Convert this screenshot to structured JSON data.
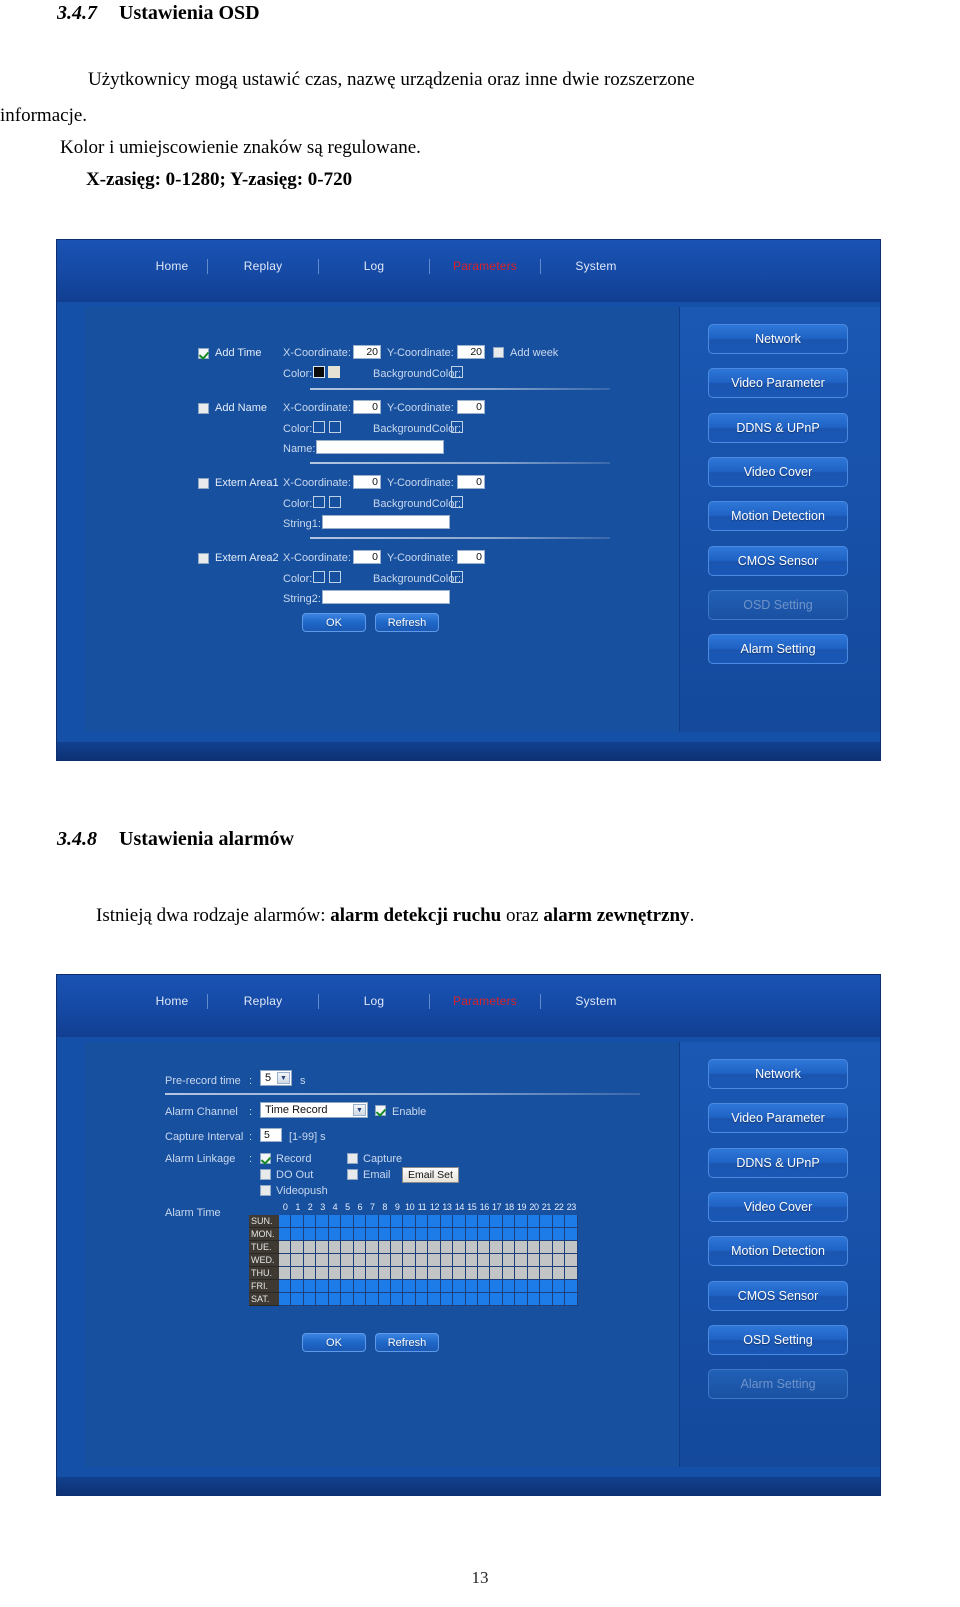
{
  "document": {
    "page_number": "13",
    "section_1": {
      "number": "3.4.7",
      "title": "Ustawienia OSD",
      "paragraph_1": "Użytkownicy mogą ustawić czas, nazwę urządzenia oraz inne dwie rozszerzone",
      "paragraph_1b": "informacje.",
      "paragraph_2": "Kolor i umiejscowienie znaków są regulowane.",
      "paragraph_3": "X-zasięg: 0-1280; Y-zasięg: 0-720"
    },
    "section_2": {
      "number": "3.4.8",
      "title": "Ustawienia alarmów",
      "paragraph_prefix": "Istnieją dwa rodzaje alarmów: ",
      "paragraph_bold_1": "alarm detekcji ruchu",
      "paragraph_middle": " oraz ",
      "paragraph_bold_2": "alarm zewnętrzny",
      "paragraph_suffix": "."
    }
  },
  "colors": {
    "app_background": "#14449c",
    "nav_active": "#d8232a",
    "grid_on": "#1e7ce8",
    "grid_off": "#c2c4c6"
  },
  "osd_screenshot": {
    "nav": {
      "items": [
        {
          "label": "Home",
          "active": false
        },
        {
          "label": "Replay",
          "active": false
        },
        {
          "label": "Log",
          "active": false
        },
        {
          "label": "Parameters",
          "active": true
        },
        {
          "label": "System",
          "active": false
        }
      ]
    },
    "sidebar": {
      "items": [
        {
          "label": "Network",
          "active": false
        },
        {
          "label": "Video Parameter",
          "active": false
        },
        {
          "label": "DDNS & UPnP",
          "active": false
        },
        {
          "label": "Video Cover",
          "active": false
        },
        {
          "label": "Motion Detection",
          "active": false
        },
        {
          "label": "CMOS Sensor",
          "active": false
        },
        {
          "label": "OSD Setting",
          "active": true
        },
        {
          "label": "Alarm Setting",
          "active": false
        }
      ]
    },
    "form": {
      "add_time": {
        "label": "Add Time",
        "checked": true,
        "x_label": "X-Coordinate:",
        "x_value": "20",
        "y_label": "Y-Coordinate:",
        "y_value": "20",
        "add_week_label": "Add week",
        "add_week_checked": false,
        "color_label": "Color:",
        "background_color_label": "BackgroundColor:"
      },
      "add_name": {
        "label": "Add Name",
        "checked": false,
        "x_label": "X-Coordinate:",
        "x_value": "0",
        "y_label": "Y-Coordinate:",
        "y_value": "0",
        "color_label": "Color:",
        "background_color_label": "BackgroundColor:",
        "name_label": "Name:",
        "name_value": ""
      },
      "extern_area1": {
        "label": "Extern Area1",
        "checked": false,
        "x_label": "X-Coordinate:",
        "x_value": "0",
        "y_label": "Y-Coordinate:",
        "y_value": "0",
        "color_label": "Color:",
        "background_color_label": "BackgroundColor:",
        "string_label": "String1:",
        "string_value": ""
      },
      "extern_area2": {
        "label": "Extern Area2",
        "checked": false,
        "x_label": "X-Coordinate:",
        "x_value": "0",
        "y_label": "Y-Coordinate:",
        "y_value": "0",
        "color_label": "Color:",
        "background_color_label": "BackgroundColor:",
        "string_label": "String2:",
        "string_value": ""
      },
      "ok_label": "OK",
      "refresh_label": "Refresh"
    }
  },
  "alarm_screenshot": {
    "nav": {
      "items": [
        {
          "label": "Home",
          "active": false
        },
        {
          "label": "Replay",
          "active": false
        },
        {
          "label": "Log",
          "active": false
        },
        {
          "label": "Parameters",
          "active": true
        },
        {
          "label": "System",
          "active": false
        }
      ]
    },
    "sidebar": {
      "items": [
        {
          "label": "Network",
          "active": false
        },
        {
          "label": "Video Parameter",
          "active": false
        },
        {
          "label": "DDNS & UPnP",
          "active": false
        },
        {
          "label": "Video Cover",
          "active": false
        },
        {
          "label": "Motion Detection",
          "active": false
        },
        {
          "label": "CMOS Sensor",
          "active": false
        },
        {
          "label": "OSD Setting",
          "active": false
        },
        {
          "label": "Alarm Setting",
          "active": true
        }
      ]
    },
    "form": {
      "pre_record_time": {
        "label": "Pre-record time",
        "colon": ":",
        "value": "5",
        "unit": "s"
      },
      "alarm_channel": {
        "label": "Alarm Channel",
        "colon": ":",
        "value": "Time Record",
        "enable_label": "Enable",
        "enable_checked": true
      },
      "capture_interval": {
        "label": "Capture Interval",
        "colon": ":",
        "value": "5",
        "range_hint": "[1-99] s"
      },
      "alarm_linkage": {
        "label": "Alarm Linkage",
        "colon": ":",
        "options": [
          {
            "label": "Record",
            "checked": true
          },
          {
            "label": "Capture",
            "checked": false
          },
          {
            "label": "DO Out",
            "checked": false
          },
          {
            "label": "Email",
            "checked": false
          },
          {
            "label": "Videopush",
            "checked": false
          }
        ],
        "email_set_label": "Email Set"
      },
      "alarm_time": {
        "label": "Alarm Time",
        "hours": [
          "0",
          "1",
          "2",
          "3",
          "4",
          "5",
          "6",
          "7",
          "8",
          "9",
          "10",
          "11",
          "12",
          "13",
          "14",
          "15",
          "16",
          "17",
          "18",
          "19",
          "20",
          "21",
          "22",
          "23"
        ],
        "days": [
          {
            "label": "SUN.",
            "selected": true
          },
          {
            "label": "MON.",
            "selected": true
          },
          {
            "label": "TUE.",
            "selected": false
          },
          {
            "label": "WED.",
            "selected": false
          },
          {
            "label": "THU.",
            "selected": false
          },
          {
            "label": "FRI.",
            "selected": true
          },
          {
            "label": "SAT.",
            "selected": true
          }
        ]
      },
      "ok_label": "OK",
      "refresh_label": "Refresh"
    }
  }
}
